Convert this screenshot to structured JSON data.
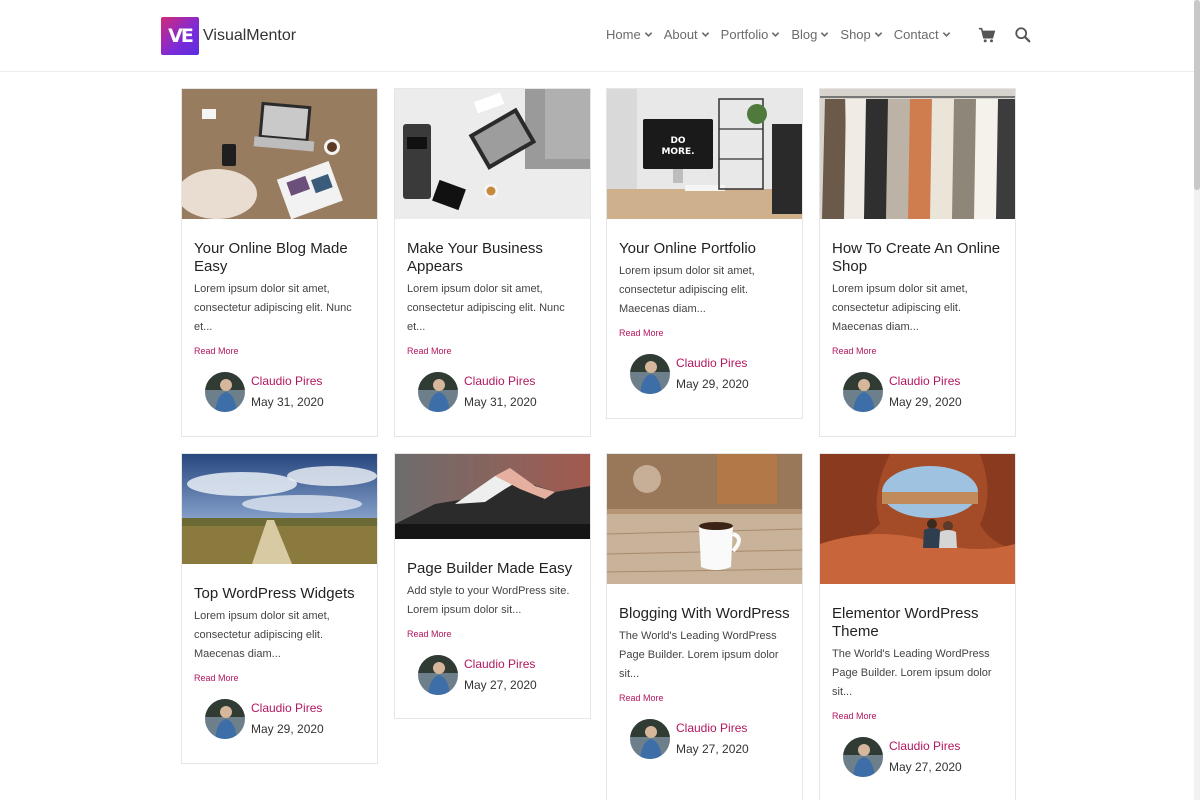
{
  "site": {
    "logo_mark": "VE",
    "logo_text": "VisualMentor"
  },
  "nav": {
    "items": [
      {
        "label": "Home"
      },
      {
        "label": "About"
      },
      {
        "label": "Portfolio"
      },
      {
        "label": "Blog"
      },
      {
        "label": "Shop"
      },
      {
        "label": "Contact"
      }
    ],
    "icons": [
      "cart-icon",
      "search-icon"
    ]
  },
  "posts": [
    {
      "title": "Your Online Blog Made Easy",
      "excerpt": "Lorem ipsum dolor sit amet, consectetur adipiscing elit. Nunc et...",
      "read_more": "Read More",
      "author": "Claudio Pires",
      "date": "May 31, 2020",
      "image": "desk-laptop-flatlay"
    },
    {
      "title": "Make Your Business Appears",
      "excerpt": "Lorem ipsum dolor sit amet, consectetur adipiscing elit. Nunc et...",
      "read_more": "Read More",
      "author": "Claudio Pires",
      "date": "May 31, 2020",
      "image": "business-laptop-desk"
    },
    {
      "title": "Your Online Portfolio",
      "excerpt": "Lorem ipsum dolor sit amet, consectetur adipiscing elit. Maecenas diam...",
      "read_more": "Read More",
      "author": "Claudio Pires",
      "date": "May 29, 2020",
      "image": "imac-do-more"
    },
    {
      "title": "How To Create An Online Shop",
      "excerpt": "Lorem ipsum dolor sit amet, consectetur adipiscing elit. Maecenas diam...",
      "read_more": "Read More",
      "author": "Claudio Pires",
      "date": "May 29, 2020",
      "image": "clothing-rack"
    },
    {
      "title": "Top WordPress Widgets",
      "excerpt": "Lorem ipsum dolor sit amet, consectetur adipiscing elit. Maecenas diam...",
      "read_more": "Read More",
      "author": "Claudio Pires",
      "date": "May 29, 2020",
      "image": "field-road-sky"
    },
    {
      "title": "Page Builder Made Easy",
      "excerpt": "Add style to your WordPress site. Lorem ipsum dolor sit...",
      "read_more": "Read More",
      "author": "Claudio Pires",
      "date": "May 27, 2020",
      "image": "mountain-sunset"
    },
    {
      "title": "Blogging With WordPress",
      "excerpt": "The World's Leading WordPress Page Builder. Lorem ipsum dolor sit...",
      "read_more": "Read More",
      "author": "Claudio Pires",
      "date": "May 27, 2020",
      "image": "coffee-mug-table"
    },
    {
      "title": "Elementor WordPress Theme",
      "excerpt": "The World's Leading WordPress Page Builder. Lorem ipsum dolor sit...",
      "read_more": "Read More",
      "author": "Claudio Pires",
      "date": "May 27, 2020",
      "image": "canyon-arch"
    }
  ],
  "colors": {
    "accent": "#b3165f",
    "logo_gradient_start": "#d12a7a",
    "logo_gradient_end": "#5b2ce0"
  }
}
